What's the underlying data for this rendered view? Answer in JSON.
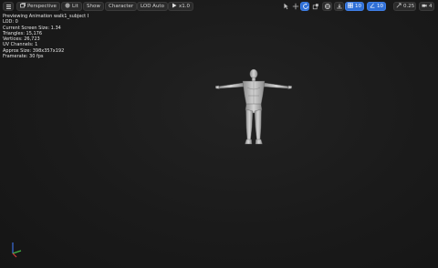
{
  "toolbar": {
    "left": [
      {
        "id": "perspective",
        "label": "Perspective",
        "icon": "perspective-icon"
      },
      {
        "id": "lit",
        "label": "Lit",
        "icon": "sphere-icon"
      },
      {
        "id": "show",
        "label": "Show",
        "icon": "eye-icon"
      },
      {
        "id": "character",
        "label": "Character",
        "icon": "character-icon"
      },
      {
        "id": "lod",
        "label": "LOD Auto",
        "icon": ""
      },
      {
        "id": "playrate",
        "label": "x1.0",
        "icon": "play-icon"
      }
    ],
    "right": {
      "grid_snap_value": "10",
      "rotation_snap_value": "10",
      "scale_snap_value": "0.25",
      "camera_speed_value": "4"
    }
  },
  "stats": [
    "Previewing Animation walk1_subject I",
    "LOD: 0",
    "Current Screen Size: 1.34",
    "Triangles: 15,176",
    "Vertices: 26,723",
    "UV Channels: 1",
    "Approx Size: 398x357x192",
    "Framerate: 30 fps"
  ],
  "colors": {
    "viewport_bg": "#1a1a1a",
    "active_accent": "#2f6fd6",
    "axis_x": "#d23c3c",
    "axis_y": "#46b446",
    "axis_z": "#3c6edc"
  }
}
